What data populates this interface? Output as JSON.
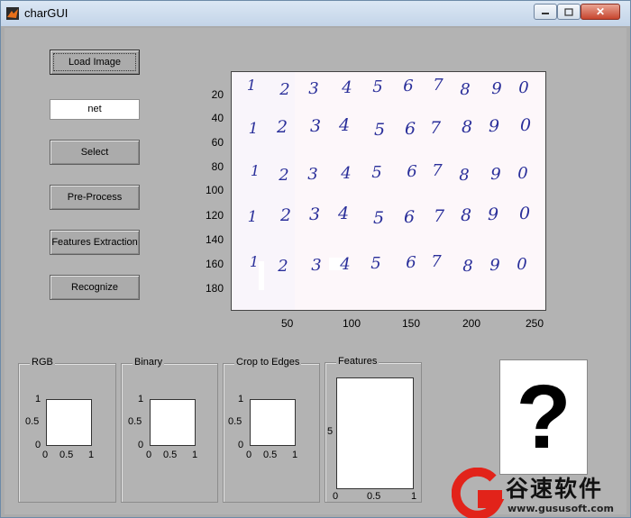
{
  "window": {
    "title": "charGUI",
    "close_glyph": "✕"
  },
  "buttons": {
    "load_image": "Load Image",
    "select": "Select",
    "pre_process": "Pre-Process",
    "features_extraction": "Features Extraction",
    "recognize": "Recognize"
  },
  "net_field": {
    "value": "net"
  },
  "main_plot": {
    "y_ticks": [
      "20",
      "40",
      "60",
      "80",
      "100",
      "120",
      "140",
      "160",
      "180"
    ],
    "x_ticks": [
      "50",
      "100",
      "150",
      "200",
      "250"
    ],
    "digit_rows": [
      [
        "1",
        "2",
        "3",
        "4",
        "5",
        "6",
        "7",
        "8",
        "9",
        "0"
      ],
      [
        "1",
        "2",
        "3",
        "4",
        "5",
        "6",
        "7",
        "8",
        "9",
        "0"
      ],
      [
        "1",
        "2",
        "3",
        "4",
        "5",
        "6",
        "7",
        "8",
        "9",
        "0"
      ],
      [
        "1",
        "2",
        "3",
        "4",
        "5",
        "6",
        "7",
        "8",
        "9",
        "0"
      ],
      [
        "1",
        "2",
        "3",
        "4",
        "5",
        "6",
        "7",
        "8",
        "9",
        "0"
      ]
    ]
  },
  "panels": {
    "rgb": {
      "title": "RGB",
      "y_ticks": [
        "1",
        "0.5",
        "0"
      ],
      "x_ticks": [
        "0",
        "0.5",
        "1"
      ]
    },
    "binary": {
      "title": "Binary",
      "y_ticks": [
        "1",
        "0.5",
        "0"
      ],
      "x_ticks": [
        "0",
        "0.5",
        "1"
      ]
    },
    "crop": {
      "title": "Crop to Edges",
      "y_ticks": [
        "1",
        "0.5",
        "0"
      ],
      "x_ticks": [
        "0",
        "0.5",
        "1"
      ]
    },
    "features": {
      "title": "Features",
      "y_ticks": [
        "5"
      ],
      "x_ticks": [
        "0",
        "0.5",
        "1"
      ]
    }
  },
  "result": {
    "symbol": "?"
  },
  "watermark": {
    "text": "谷速软件",
    "url": "www.gususoft.com"
  },
  "colors": {
    "ink": "#2a2f9a",
    "plot_bg": "#fdf7fa",
    "watermark_red": "#e2231a"
  }
}
